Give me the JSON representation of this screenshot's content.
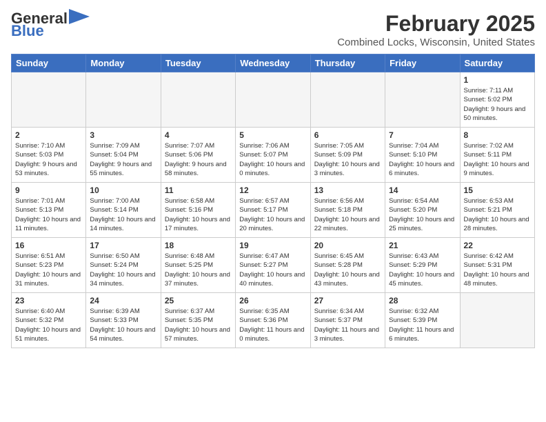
{
  "header": {
    "logo_general": "General",
    "logo_blue": "Blue",
    "month": "February 2025",
    "location": "Combined Locks, Wisconsin, United States"
  },
  "weekdays": [
    "Sunday",
    "Monday",
    "Tuesday",
    "Wednesday",
    "Thursday",
    "Friday",
    "Saturday"
  ],
  "weeks": [
    [
      {
        "day": "",
        "empty": true
      },
      {
        "day": "",
        "empty": true
      },
      {
        "day": "",
        "empty": true
      },
      {
        "day": "",
        "empty": true
      },
      {
        "day": "",
        "empty": true
      },
      {
        "day": "",
        "empty": true
      },
      {
        "day": "1",
        "info": "Sunrise: 7:11 AM\nSunset: 5:02 PM\nDaylight: 9 hours and 50 minutes."
      }
    ],
    [
      {
        "day": "2",
        "info": "Sunrise: 7:10 AM\nSunset: 5:03 PM\nDaylight: 9 hours and 53 minutes."
      },
      {
        "day": "3",
        "info": "Sunrise: 7:09 AM\nSunset: 5:04 PM\nDaylight: 9 hours and 55 minutes."
      },
      {
        "day": "4",
        "info": "Sunrise: 7:07 AM\nSunset: 5:06 PM\nDaylight: 9 hours and 58 minutes."
      },
      {
        "day": "5",
        "info": "Sunrise: 7:06 AM\nSunset: 5:07 PM\nDaylight: 10 hours and 0 minutes."
      },
      {
        "day": "6",
        "info": "Sunrise: 7:05 AM\nSunset: 5:09 PM\nDaylight: 10 hours and 3 minutes."
      },
      {
        "day": "7",
        "info": "Sunrise: 7:04 AM\nSunset: 5:10 PM\nDaylight: 10 hours and 6 minutes."
      },
      {
        "day": "8",
        "info": "Sunrise: 7:02 AM\nSunset: 5:11 PM\nDaylight: 10 hours and 9 minutes."
      }
    ],
    [
      {
        "day": "9",
        "info": "Sunrise: 7:01 AM\nSunset: 5:13 PM\nDaylight: 10 hours and 11 minutes."
      },
      {
        "day": "10",
        "info": "Sunrise: 7:00 AM\nSunset: 5:14 PM\nDaylight: 10 hours and 14 minutes."
      },
      {
        "day": "11",
        "info": "Sunrise: 6:58 AM\nSunset: 5:16 PM\nDaylight: 10 hours and 17 minutes."
      },
      {
        "day": "12",
        "info": "Sunrise: 6:57 AM\nSunset: 5:17 PM\nDaylight: 10 hours and 20 minutes."
      },
      {
        "day": "13",
        "info": "Sunrise: 6:56 AM\nSunset: 5:18 PM\nDaylight: 10 hours and 22 minutes."
      },
      {
        "day": "14",
        "info": "Sunrise: 6:54 AM\nSunset: 5:20 PM\nDaylight: 10 hours and 25 minutes."
      },
      {
        "day": "15",
        "info": "Sunrise: 6:53 AM\nSunset: 5:21 PM\nDaylight: 10 hours and 28 minutes."
      }
    ],
    [
      {
        "day": "16",
        "info": "Sunrise: 6:51 AM\nSunset: 5:23 PM\nDaylight: 10 hours and 31 minutes."
      },
      {
        "day": "17",
        "info": "Sunrise: 6:50 AM\nSunset: 5:24 PM\nDaylight: 10 hours and 34 minutes."
      },
      {
        "day": "18",
        "info": "Sunrise: 6:48 AM\nSunset: 5:25 PM\nDaylight: 10 hours and 37 minutes."
      },
      {
        "day": "19",
        "info": "Sunrise: 6:47 AM\nSunset: 5:27 PM\nDaylight: 10 hours and 40 minutes."
      },
      {
        "day": "20",
        "info": "Sunrise: 6:45 AM\nSunset: 5:28 PM\nDaylight: 10 hours and 43 minutes."
      },
      {
        "day": "21",
        "info": "Sunrise: 6:43 AM\nSunset: 5:29 PM\nDaylight: 10 hours and 45 minutes."
      },
      {
        "day": "22",
        "info": "Sunrise: 6:42 AM\nSunset: 5:31 PM\nDaylight: 10 hours and 48 minutes."
      }
    ],
    [
      {
        "day": "23",
        "info": "Sunrise: 6:40 AM\nSunset: 5:32 PM\nDaylight: 10 hours and 51 minutes."
      },
      {
        "day": "24",
        "info": "Sunrise: 6:39 AM\nSunset: 5:33 PM\nDaylight: 10 hours and 54 minutes."
      },
      {
        "day": "25",
        "info": "Sunrise: 6:37 AM\nSunset: 5:35 PM\nDaylight: 10 hours and 57 minutes."
      },
      {
        "day": "26",
        "info": "Sunrise: 6:35 AM\nSunset: 5:36 PM\nDaylight: 11 hours and 0 minutes."
      },
      {
        "day": "27",
        "info": "Sunrise: 6:34 AM\nSunset: 5:37 PM\nDaylight: 11 hours and 3 minutes."
      },
      {
        "day": "28",
        "info": "Sunrise: 6:32 AM\nSunset: 5:39 PM\nDaylight: 11 hours and 6 minutes."
      },
      {
        "day": "",
        "empty": true
      }
    ]
  ]
}
